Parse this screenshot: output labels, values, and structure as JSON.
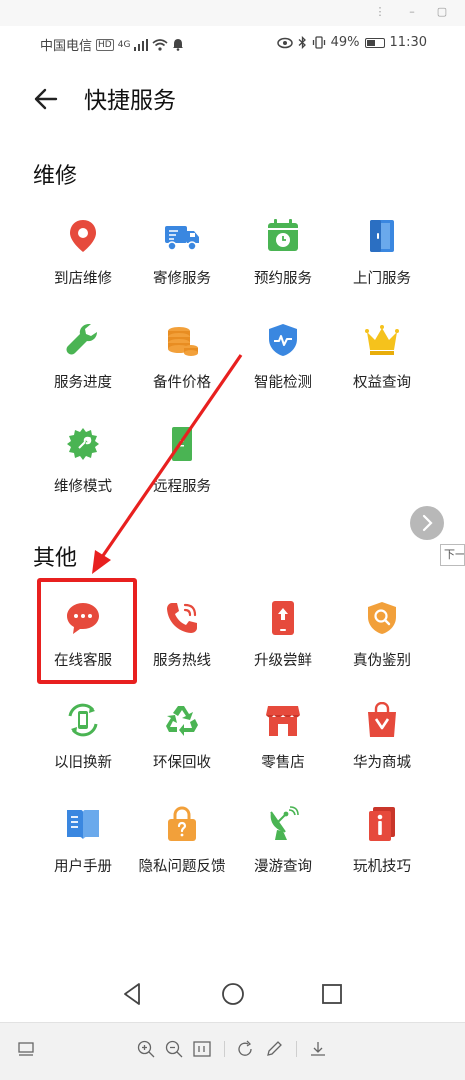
{
  "status_bar": {
    "carrier": "中国电信",
    "network_badge": "HD",
    "network_type": "4G",
    "battery": "49%",
    "time": "11:30"
  },
  "header": {
    "title": "快捷服务"
  },
  "sections": {
    "repair": {
      "title": "维修",
      "items": [
        {
          "label": "到店维修",
          "icon": "location-pin-icon",
          "color": "#e64a3c"
        },
        {
          "label": "寄修服务",
          "icon": "delivery-truck-icon",
          "color": "#3a87e0"
        },
        {
          "label": "预约服务",
          "icon": "calendar-clock-icon",
          "color": "#4ab453"
        },
        {
          "label": "上门服务",
          "icon": "door-icon",
          "color": "#3a87e0"
        },
        {
          "label": "服务进度",
          "icon": "wrench-icon",
          "color": "#4ab453"
        },
        {
          "label": "备件价格",
          "icon": "coins-icon",
          "color": "#f2a03a"
        },
        {
          "label": "智能检测",
          "icon": "shield-pulse-icon",
          "color": "#3a87e0"
        },
        {
          "label": "权益查询",
          "icon": "crown-icon",
          "color": "#f5c21c"
        },
        {
          "label": "维修模式",
          "icon": "gear-wrench-icon",
          "color": "#4ab453"
        },
        {
          "label": "远程服务",
          "icon": "remote-device-icon",
          "color": "#4ab453"
        }
      ]
    },
    "other": {
      "title": "其他",
      "items": [
        {
          "label": "在线客服",
          "icon": "chat-bubble-icon",
          "color": "#e64a3c"
        },
        {
          "label": "服务热线",
          "icon": "phone-call-icon",
          "color": "#e64a3c"
        },
        {
          "label": "升级尝鲜",
          "icon": "phone-upgrade-icon",
          "color": "#e64a3c"
        },
        {
          "label": "真伪鉴别",
          "icon": "search-shield-icon",
          "color": "#f2a03a"
        },
        {
          "label": "以旧换新",
          "icon": "trade-in-icon",
          "color": "#4ab453"
        },
        {
          "label": "环保回收",
          "icon": "recycle-icon",
          "color": "#4ab453"
        },
        {
          "label": "零售店",
          "icon": "store-icon",
          "color": "#e64a3c"
        },
        {
          "label": "华为商城",
          "icon": "shopping-bag-icon",
          "color": "#e64a3c"
        },
        {
          "label": "用户手册",
          "icon": "book-icon",
          "color": "#3a87e0"
        },
        {
          "label": "隐私问题反馈",
          "icon": "lock-question-icon",
          "color": "#f2a03a"
        },
        {
          "label": "漫游查询",
          "icon": "satellite-dish-icon",
          "color": "#4ab453"
        },
        {
          "label": "玩机技巧",
          "icon": "tips-icon",
          "color": "#e64a3c"
        }
      ]
    }
  },
  "overlay": {
    "next_tip": "下一"
  },
  "accent_color": "#e8201f"
}
